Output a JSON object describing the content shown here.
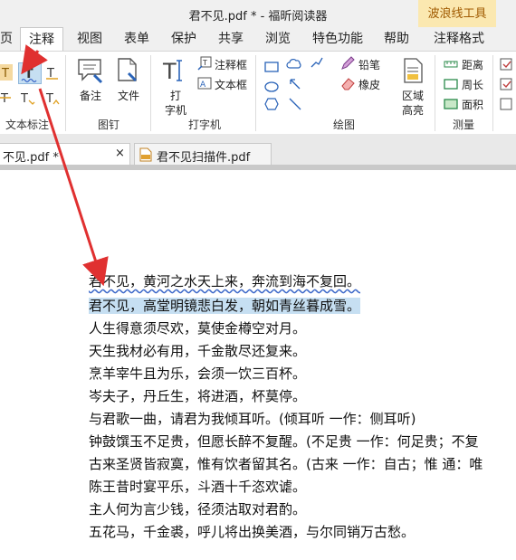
{
  "window": {
    "title": "君不见.pdf * - 福昕阅读器",
    "context_tool_label": "波浪线工具"
  },
  "ribbon_tabs": [
    "页",
    "注释",
    "视图",
    "表单",
    "保护",
    "共享",
    "浏览",
    "特色功能",
    "帮助",
    "注释格式"
  ],
  "ribbon": {
    "groups": {
      "text_markup": "文本标注",
      "pin": "图钉",
      "typewriter": "打字机",
      "drawing": "绘图",
      "measure": "测量"
    },
    "note_label": "备注",
    "file_label": "文件",
    "typewriter_label_1": "打",
    "typewriter_label_2": "字机",
    "callout_label": "注释框",
    "textbox_label": "文本框",
    "pencil_label": "铅笔",
    "eraser_label": "橡皮",
    "area_highlight_1": "区域",
    "area_highlight_2": "高亮",
    "distance_label": "距离",
    "perimeter_label": "周长",
    "area_label": "面积"
  },
  "doc_tabs": [
    {
      "label": "不见.pdf *",
      "close": "×"
    },
    {
      "label": "君不见扫描件.pdf"
    }
  ],
  "poem": [
    "君不见，黄河之水天上来，奔流到海不复回。",
    "君不见，高堂明镜悲白发，朝如青丝暮成雪。",
    "人生得意须尽欢，莫使金樽空对月。",
    "天生我材必有用，千金散尽还复来。",
    "烹羊宰牛且为乐，会须一饮三百杯。",
    "岑夫子，丹丘生，将进酒，杯莫停。",
    "与君歌一曲，请君为我倾耳听。(倾耳听  一作：侧耳听)",
    "钟鼓馔玉不足贵，但愿长醉不复醒。(不足贵  一作：何足贵；不复",
    "古来圣贤皆寂寞，惟有饮者留其名。(古来  一作：自古；惟  通：唯",
    "陈王昔时宴平乐，斗酒十千恣欢谑。",
    "主人何为言少钱，径须沽取对君酌。",
    "五花马，千金裘，呼儿将出换美酒，与尔同销万古愁。"
  ],
  "colors": {
    "arrow": "#e03030",
    "highlight": "#c6dff2",
    "wavy_underline": "#3a66c8",
    "context_tab_bg": "#fbe8b0"
  }
}
